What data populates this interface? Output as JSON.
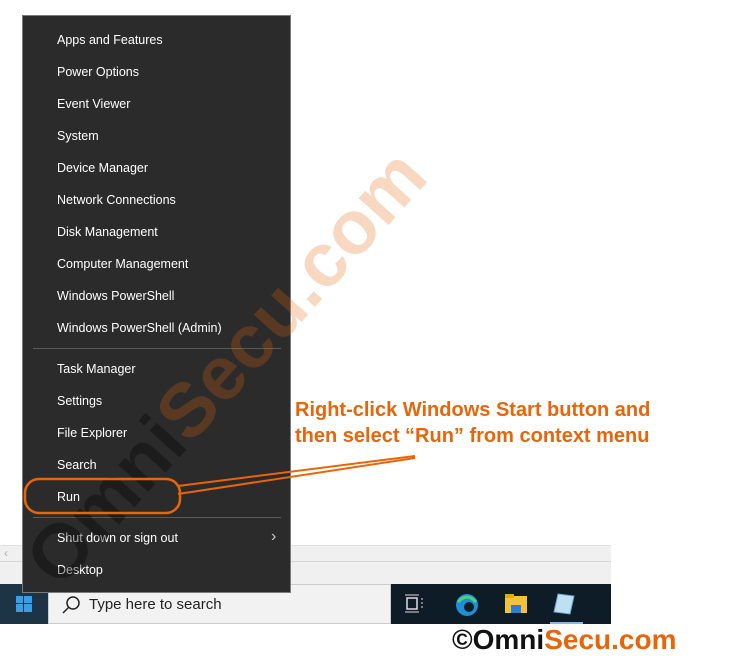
{
  "menu": {
    "group1": [
      "Apps and Features",
      "Power Options",
      "Event Viewer",
      "System",
      "Device Manager",
      "Network Connections",
      "Disk Management",
      "Computer Management",
      "Windows PowerShell",
      "Windows PowerShell (Admin)"
    ],
    "group2": [
      "Task Manager",
      "Settings",
      "File Explorer",
      "Search",
      "Run"
    ],
    "group3": [
      "Shut down or sign out",
      "Desktop"
    ]
  },
  "taskbar": {
    "search_placeholder": "Type here to search"
  },
  "annotation": {
    "line1": "Right-click Windows Start button and",
    "line2": "then select “Run” from context menu",
    "color": "#e8650a"
  },
  "watermark": "OmniSecu.com",
  "footer": {
    "copyright": "©Omni",
    "brand": "Secu.com"
  }
}
